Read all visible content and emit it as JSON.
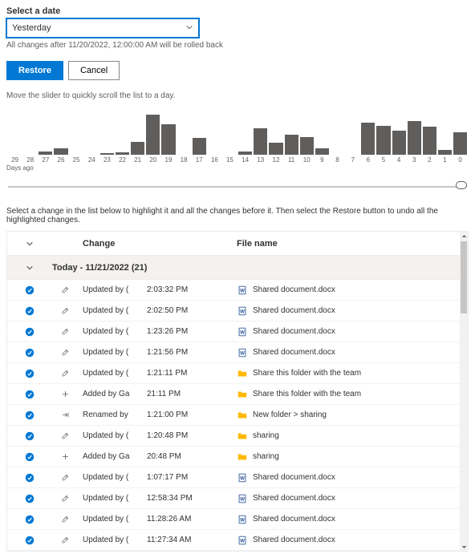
{
  "dateLabel": "Select a date",
  "dateValue": "Yesterday",
  "rollbackHint": "All changes after 11/20/2022, 12:00:00 AM will be rolled back",
  "restoreLabel": "Restore",
  "cancelLabel": "Cancel",
  "sliderHint": "Move the slider to quickly scroll the list to a day.",
  "axisLabel": "Days ago",
  "listHint": "Select a change in the list below to highlight it and all the changes before it. Then select the Restore button to undo all the highlighted changes.",
  "hdrChange": "Change",
  "hdrFile": "File name",
  "groupLabel": "Today - 11/21/2022 (21)",
  "chart_data": {
    "type": "bar",
    "title": "",
    "xlabel": "Days ago",
    "ylabel": "",
    "ylim": [
      0,
      50
    ],
    "categories": [
      29,
      28,
      27,
      26,
      25,
      24,
      23,
      22,
      21,
      20,
      19,
      18,
      17,
      16,
      15,
      14,
      13,
      12,
      11,
      10,
      9,
      8,
      7,
      6,
      5,
      4,
      3,
      2,
      1,
      0
    ],
    "values": [
      0,
      0,
      4,
      8,
      0,
      0,
      2,
      3,
      16,
      50,
      38,
      0,
      21,
      0,
      0,
      4,
      33,
      15,
      25,
      22,
      8,
      0,
      0,
      40,
      36,
      30,
      42,
      35,
      6,
      28
    ]
  },
  "rows": [
    {
      "act": "edit",
      "change": "Updated by (",
      "time": "2:03:32 PM",
      "ficon": "doc",
      "file": "Shared document.docx"
    },
    {
      "act": "edit",
      "change": "Updated by (",
      "time": "2:02:50 PM",
      "ficon": "doc",
      "file": "Shared document.docx"
    },
    {
      "act": "edit",
      "change": "Updated by (",
      "time": "1:23:26 PM",
      "ficon": "doc",
      "file": "Shared document.docx"
    },
    {
      "act": "edit",
      "change": "Updated by (",
      "time": "1:21:56 PM",
      "ficon": "doc",
      "file": "Shared document.docx"
    },
    {
      "act": "edit",
      "change": "Updated by (",
      "time": "1:21:11 PM",
      "ficon": "folder",
      "file": "Share this folder with the team"
    },
    {
      "act": "add",
      "change": "Added by Ga",
      "time": "21:11 PM",
      "ficon": "folder",
      "file": "Share this folder with the team"
    },
    {
      "act": "rename",
      "change": "Renamed by",
      "time": "1:21:00 PM",
      "ficon": "folder",
      "file": "New folder > sharing"
    },
    {
      "act": "edit",
      "change": "Updated by (",
      "time": "1:20:48 PM",
      "ficon": "folder",
      "file": "sharing"
    },
    {
      "act": "add",
      "change": "Added by Ga",
      "time": "20:48 PM",
      "ficon": "folder",
      "file": "sharing"
    },
    {
      "act": "edit",
      "change": "Updated by (",
      "time": "1:07:17 PM",
      "ficon": "doc",
      "file": "Shared document.docx"
    },
    {
      "act": "edit",
      "change": "Updated by (",
      "time": "12:58:34 PM",
      "ficon": "doc",
      "file": "Shared document.docx"
    },
    {
      "act": "edit",
      "change": "Updated by (",
      "time": "11:28:26 AM",
      "ficon": "doc",
      "file": "Shared document.docx"
    },
    {
      "act": "edit",
      "change": "Updated by (",
      "time": "11:27:34 AM",
      "ficon": "doc",
      "file": "Shared document.docx"
    }
  ]
}
